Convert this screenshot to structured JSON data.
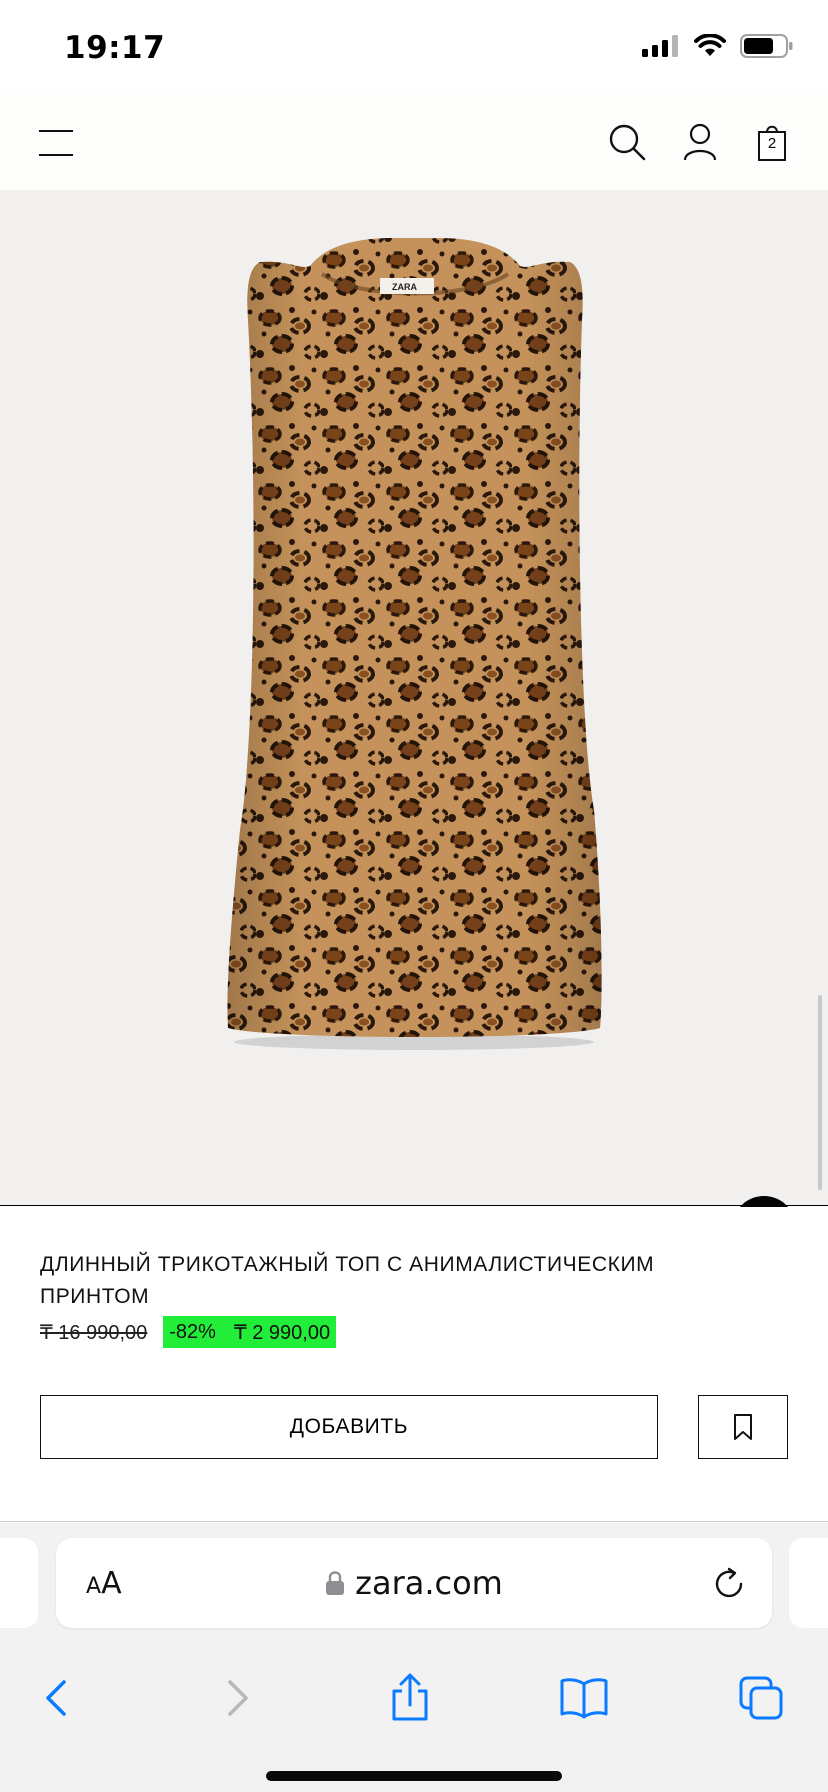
{
  "status_bar": {
    "time": "19:17"
  },
  "header": {
    "cart_count": "2"
  },
  "product": {
    "title": "ДЛИННЫЙ ТРИКОТАЖНЫЙ ТОП С АНИМАЛИСТИЧЕСКИМ ПРИНТОМ",
    "old_price": "₸ 16 990,00",
    "discount": "-82%",
    "new_price": "₸ 2 990,00",
    "add_label": "ДОБАВИТЬ",
    "label_brand": "ZARA"
  },
  "browser": {
    "text_size_label_small": "A",
    "text_size_label_big": "A",
    "url": "zara.com"
  },
  "colors": {
    "sale_highlight": "#22ee3a",
    "ios_blue": "#0a7aff",
    "ios_disabled": "#b7b7bc",
    "image_background": "#f1f0ef"
  },
  "icons": [
    "menu-icon",
    "search-icon",
    "user-icon",
    "bag-icon",
    "accessibility-icon",
    "bookmark-icon",
    "lock-icon",
    "reload-icon",
    "back-icon",
    "forward-icon",
    "share-icon",
    "bookmarks-icon",
    "tabs-icon"
  ]
}
